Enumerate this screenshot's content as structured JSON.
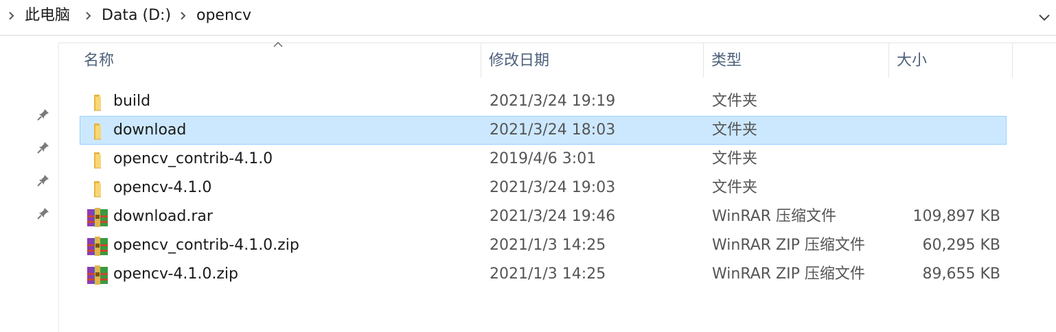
{
  "breadcrumb": {
    "items": [
      "此电脑",
      "Data (D:)",
      "opencv"
    ]
  },
  "columns": {
    "name": "名称",
    "date": "修改日期",
    "type": "类型",
    "size": "大小"
  },
  "files": [
    {
      "name": "build",
      "date": "2021/3/24 19:19",
      "type": "文件夹",
      "size": "",
      "icon": "folder-icon",
      "selected": false
    },
    {
      "name": "download",
      "date": "2021/3/24 18:03",
      "type": "文件夹",
      "size": "",
      "icon": "folder-icon",
      "selected": true
    },
    {
      "name": "opencv_contrib-4.1.0",
      "date": "2019/4/6 3:01",
      "type": "文件夹",
      "size": "",
      "icon": "folder-icon",
      "selected": false
    },
    {
      "name": "opencv-4.1.0",
      "date": "2021/3/24 19:03",
      "type": "文件夹",
      "size": "",
      "icon": "folder-icon",
      "selected": false
    },
    {
      "name": "download.rar",
      "date": "2021/3/24 19:46",
      "type": "WinRAR 压缩文件",
      "size": "109,897 KB",
      "icon": "winrar-archive-icon",
      "selected": false
    },
    {
      "name": "opencv_contrib-4.1.0.zip",
      "date": "2021/1/3 14:25",
      "type": "WinRAR ZIP 压缩文件",
      "size": "60,295 KB",
      "icon": "winrar-archive-icon",
      "selected": false
    },
    {
      "name": "opencv-4.1.0.zip",
      "date": "2021/1/3 14:25",
      "type": "WinRAR ZIP 压缩文件",
      "size": "89,655 KB",
      "icon": "winrar-archive-icon",
      "selected": false
    }
  ],
  "colors": {
    "selection_bg": "#cce8ff",
    "selection_border": "#99d1ff",
    "header_text": "#4c607a",
    "folder_yellow": "#f8d775"
  }
}
